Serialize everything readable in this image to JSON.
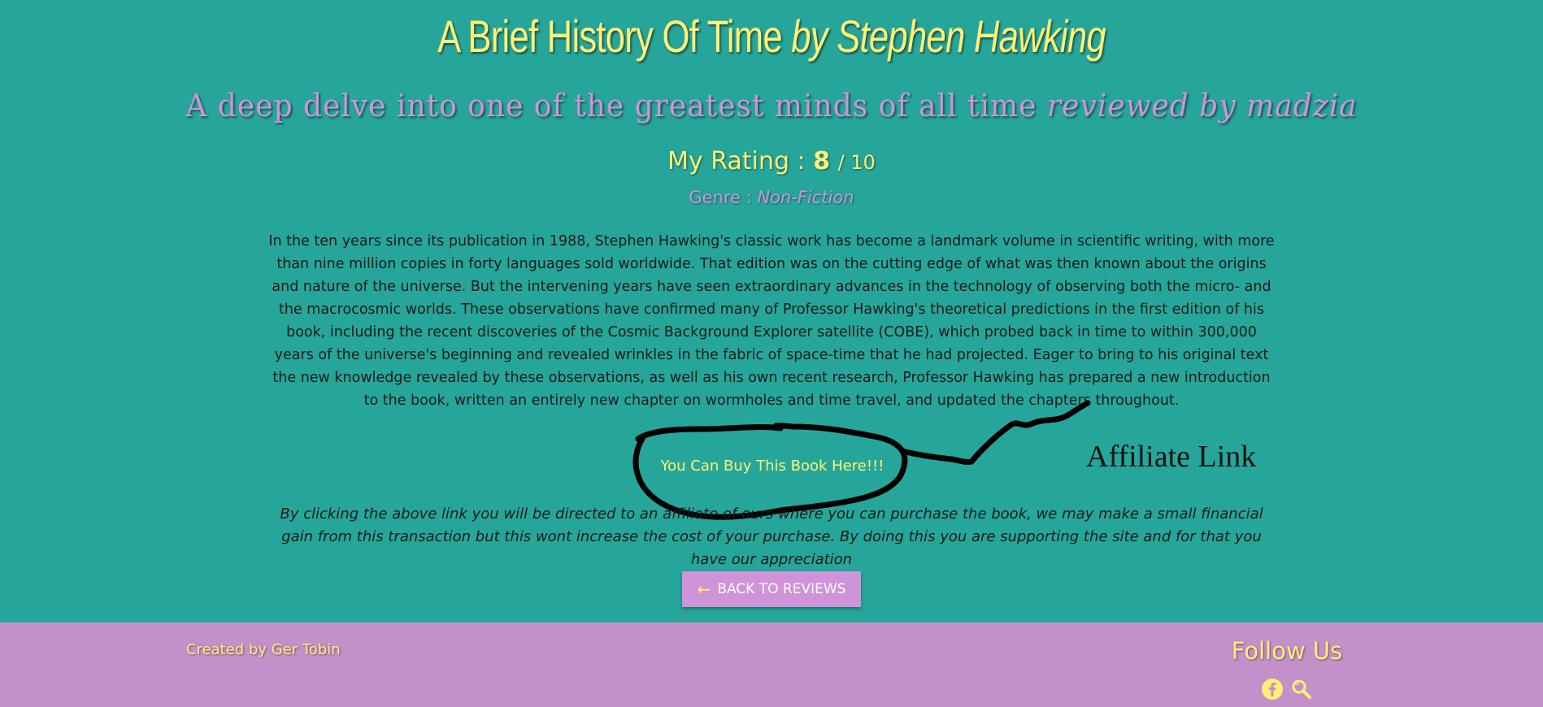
{
  "header": {
    "title": "A Brief History Of Time",
    "author": "by Stephen Hawking",
    "subtitle": "A deep delve into one of the greatest minds of all time",
    "reviewer": "reviewed by madzia"
  },
  "rating": {
    "label": "My Rating :",
    "score": "8",
    "max": "/ 10"
  },
  "genre": {
    "label": "Genre :",
    "value": "Non-Fiction"
  },
  "description": "In the ten years since its publication in 1988, Stephen Hawking's classic work has become a landmark volume in scientific writing, with more than nine million copies in forty languages sold worldwide. That edition was on the cutting edge of what was then known about the origins and nature of the universe. But the intervening years have seen extraordinary advances in the technology of observing both the micro- and the macrocosmic worlds. These observations have confirmed many of Professor Hawking's theoretical predictions in the first edition of his book, including the recent discoveries of the Cosmic Background Explorer satellite (COBE), which probed back in time to within 300,000 years of the universe's beginning and revealed wrinkles in the fabric of space-time that he had projected. Eager to bring to his original text the new knowledge revealed by these observations, as well as his own recent research, Professor Hawking has prepared a new introduction to the book, written an entirely new chapter on wormholes and time travel, and updated the chapters throughout.",
  "buy_link": "You Can Buy This Book Here!!!",
  "annotation": "Affiliate Link",
  "disclaimer": "By clicking the above link you will be directed to an affiliate of ours where you can purchase the book, we may make a small financial gain from this transaction but this wont increase the cost of your purchase. By doing this you are supporting the site and for that you have our appreciation",
  "back_button": {
    "label": "BACK TO REVIEWS",
    "icon": "arrow-left-icon"
  },
  "footer": {
    "created_by": "Created by Ger Tobin",
    "follow_label": "Follow Us",
    "social_icons": [
      "facebook-icon",
      "search-icon"
    ]
  },
  "colors": {
    "background": "#26a69a",
    "accent_yellow": "#fff176",
    "accent_purple": "#ce93d8",
    "footer": "#c490c9"
  }
}
